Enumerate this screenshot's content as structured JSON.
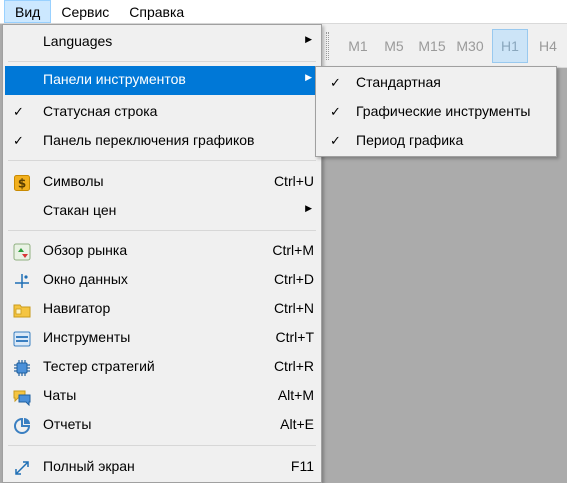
{
  "menubar": {
    "items": [
      {
        "label": "Вид",
        "active": true
      },
      {
        "label": "Сервис"
      },
      {
        "label": "Справка"
      }
    ]
  },
  "toolbar": {
    "timeframes": [
      "M1",
      "M5",
      "M15",
      "M30",
      "H1",
      "H4"
    ],
    "selected": "H1"
  },
  "view_menu": {
    "languages": {
      "label": "Languages"
    },
    "toolbars": {
      "label": "Панели инструментов",
      "highlighted": true
    },
    "status_bar": {
      "label": "Статусная строка",
      "checked": true
    },
    "chart_tabs": {
      "label": "Панель переключения графиков",
      "checked": true
    },
    "symbols": {
      "label": "Символы",
      "shortcut": "Ctrl+U",
      "icon": "dollar-icon"
    },
    "depth_of_market": {
      "label": "Стакан цен"
    },
    "market_watch": {
      "label": "Обзор рынка",
      "shortcut": "Ctrl+M",
      "icon": "market-watch-icon"
    },
    "data_window": {
      "label": "Окно данных",
      "shortcut": "Ctrl+D",
      "icon": "crosshair-icon"
    },
    "navigator": {
      "label": "Навигатор",
      "shortcut": "Ctrl+N",
      "icon": "folder-icon"
    },
    "toolbox": {
      "label": "Инструменты",
      "shortcut": "Ctrl+T",
      "icon": "toolbox-icon"
    },
    "strategy_tester": {
      "label": "Тестер стратегий",
      "shortcut": "Ctrl+R",
      "icon": "chip-icon"
    },
    "chats": {
      "label": "Чаты",
      "shortcut": "Alt+M",
      "icon": "chat-icon"
    },
    "reports": {
      "label": "Отчеты",
      "shortcut": "Alt+E",
      "icon": "reports-icon"
    },
    "fullscreen": {
      "label": "Полный экран",
      "shortcut": "F11",
      "icon": "fullscreen-icon"
    }
  },
  "toolbars_submenu": {
    "items": [
      {
        "label": "Стандартная",
        "checked": true
      },
      {
        "label": "Графические инструменты",
        "checked": true
      },
      {
        "label": "Период графика",
        "checked": true
      }
    ]
  },
  "colors": {
    "highlight": "#0078d7",
    "menu_bg": "#f0f0f0",
    "workspace_bg": "#ababab"
  }
}
